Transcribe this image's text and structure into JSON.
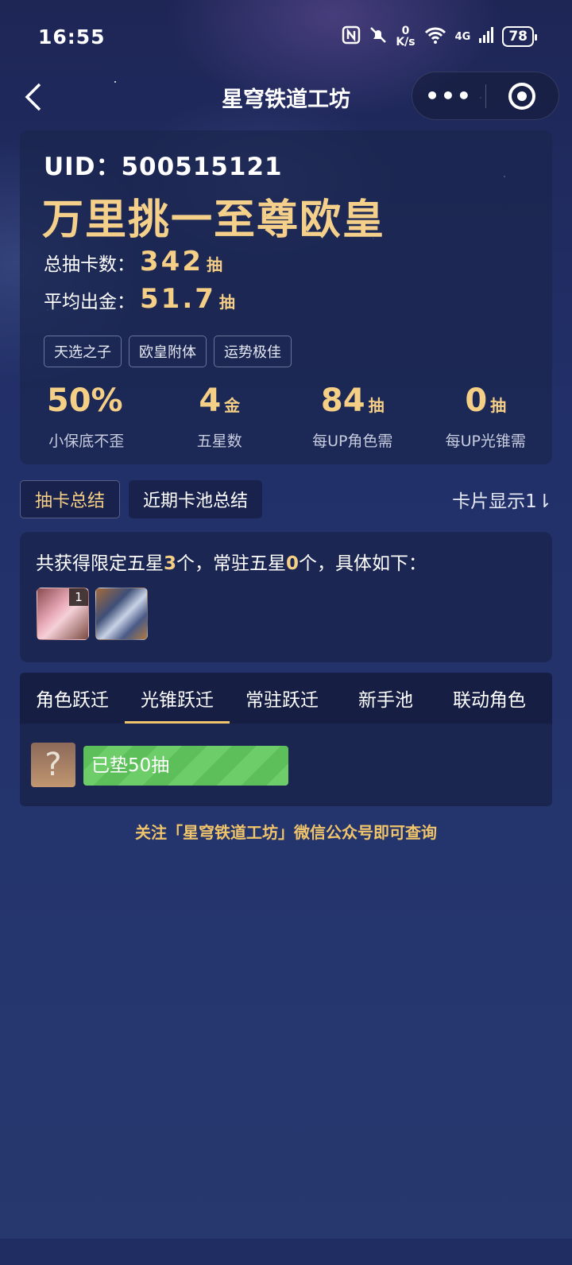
{
  "status": {
    "time": "16:55",
    "net_speed_top": "0",
    "net_speed_unit": "K/s",
    "network": "4G",
    "battery": "78"
  },
  "nav": {
    "title": "星穹铁道工坊",
    "more_label": "•••"
  },
  "summary": {
    "uid_label": "UID：",
    "uid_value": "500515121",
    "rank_title": "万里挑一至尊欧皇",
    "total_label": "总抽卡数：",
    "total_value": "342",
    "total_unit": "抽",
    "avg_label": "平均出金：",
    "avg_value": "51.7",
    "avg_unit": "抽",
    "tags": [
      "天选之子",
      "欧皇附体",
      "运势极佳"
    ],
    "metrics": [
      {
        "value": "50%",
        "unit": "",
        "label": "小保底不歪"
      },
      {
        "value": "4",
        "unit": "金",
        "label": "五星数"
      },
      {
        "value": "84",
        "unit": "抽",
        "label": "每UP角色需"
      },
      {
        "value": "0",
        "unit": "抽",
        "label": "每UP光锥需"
      }
    ]
  },
  "tabs": {
    "draw_summary": "抽卡总结",
    "recent_pool_summary": "近期卡池总结",
    "card_display": "卡片显示1⇂"
  },
  "obtained": {
    "prefix": "共获得限定五星",
    "limited_count": "3",
    "middle": "个，常驻五星",
    "standard_count": "0",
    "suffix": "个，具体如下：",
    "avatar_badge": "1"
  },
  "pool_tabs": [
    "角色跃迁",
    "光锥跃迁",
    "常驻跃迁",
    "新手池",
    "联动角色"
  ],
  "pool_active_index": 1,
  "pity": {
    "mystery_symbol": "?",
    "progress_text": "已垫50抽"
  },
  "footer": {
    "note": "关注「星穹铁道工坊」微信公众号即可查询"
  }
}
